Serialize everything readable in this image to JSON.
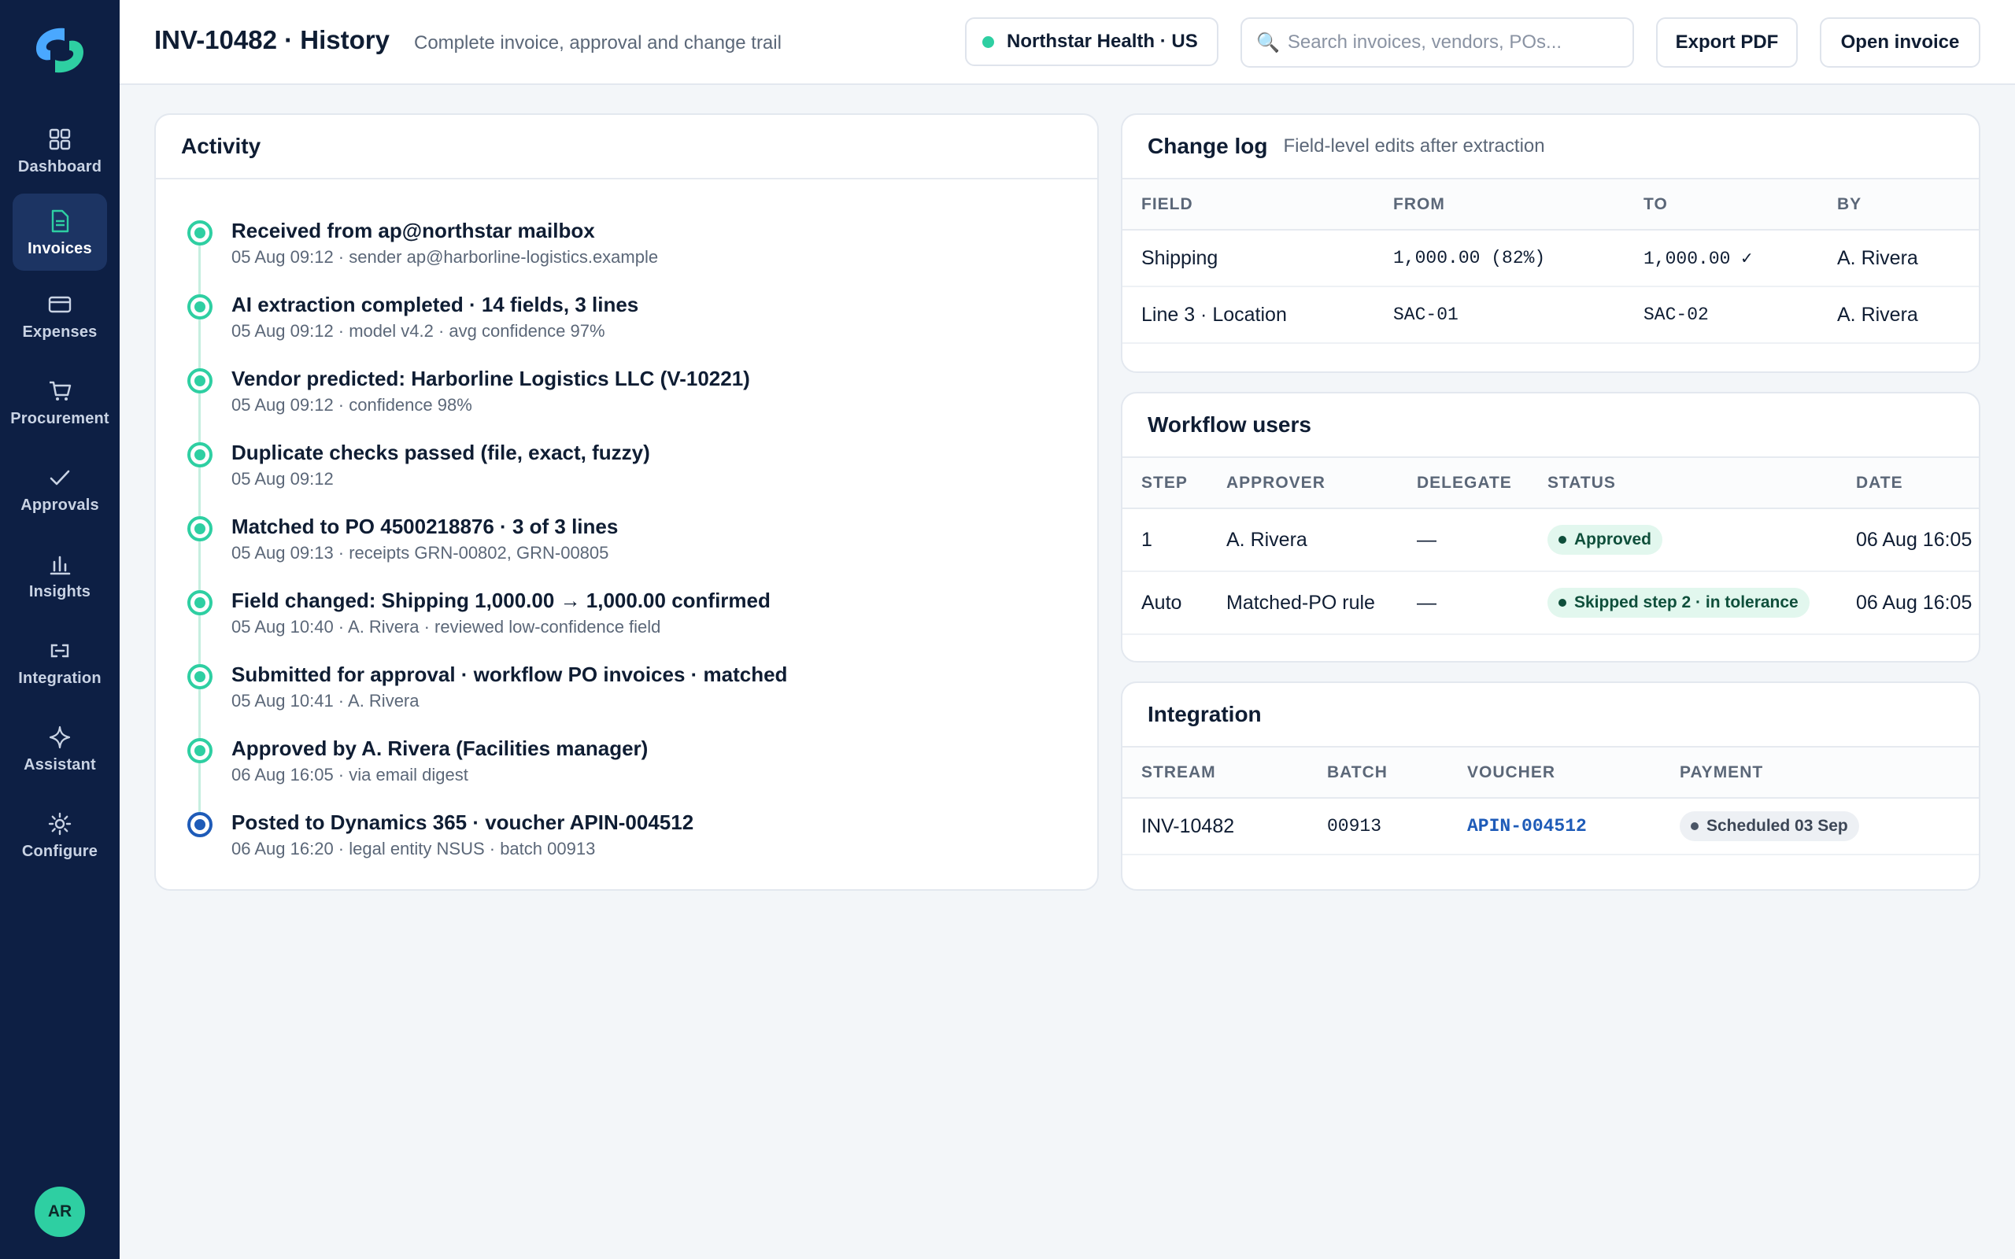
{
  "nav": {
    "items": [
      {
        "label": "Dashboard",
        "icon": "dashboard-icon"
      },
      {
        "label": "Invoices",
        "icon": "document-icon",
        "active": true
      },
      {
        "label": "Expenses",
        "icon": "card-icon"
      },
      {
        "label": "Procurement",
        "icon": "cart-icon"
      },
      {
        "label": "Approvals",
        "icon": "check-icon"
      },
      {
        "label": "Insights",
        "icon": "bar-chart-icon"
      },
      {
        "label": "Integration",
        "icon": "link-icon"
      },
      {
        "label": "Assistant",
        "icon": "sparkle-icon"
      },
      {
        "label": "Configure",
        "icon": "gear-icon"
      }
    ],
    "avatar": "AR"
  },
  "header": {
    "title": "INV-10482 · History",
    "subtitle": "Complete invoice, approval and change trail",
    "entity": "Northstar Health · US",
    "search_placeholder": "Search invoices, vendors, POs...",
    "export_label": "Export PDF",
    "open_label": "Open invoice"
  },
  "activity": {
    "title": "Activity",
    "items": [
      {
        "title": "Received from ap@northstar mailbox",
        "meta": "05 Aug 09:12 · sender ap@harborline-logistics.example"
      },
      {
        "title": "AI extraction completed · 14 fields, 3 lines",
        "meta": "05 Aug 09:12 · model v4.2 · avg confidence 97%"
      },
      {
        "title": "Vendor predicted: Harborline Logistics LLC (V-10221)",
        "meta": "05 Aug 09:12 · confidence 98%"
      },
      {
        "title": "Duplicate checks passed (file, exact, fuzzy)",
        "meta": "05 Aug 09:12"
      },
      {
        "title": "Matched to PO 4500218876 · 3 of 3 lines",
        "meta": "05 Aug 09:13 · receipts GRN-00802, GRN-00805"
      },
      {
        "title": "Field changed: Shipping 1,000.00 → 1,000.00 confirmed",
        "meta": "05 Aug 10:40 · A. Rivera · reviewed low-confidence field"
      },
      {
        "title": "Submitted for approval · workflow PO invoices · matched",
        "meta": "05 Aug 10:41 · A. Rivera"
      },
      {
        "title": "Approved by A. Rivera (Facilities manager)",
        "meta": "06 Aug 16:05 · via email digest"
      },
      {
        "title": "Posted to Dynamics 365 · voucher APIN-004512",
        "meta": "06 Aug 16:20 · legal entity NSUS · batch 00913"
      }
    ]
  },
  "changelog": {
    "title": "Change log",
    "subtitle": "Field-level edits after extraction",
    "columns": [
      "FIELD",
      "FROM",
      "TO",
      "BY"
    ],
    "rows": [
      [
        "Shipping",
        "1,000.00 (82%)",
        "1,000.00 ✓",
        "A. Rivera"
      ],
      [
        "Line 3 · Location",
        "SAC-01",
        "SAC-02",
        "A. Rivera"
      ]
    ]
  },
  "workflow": {
    "title": "Workflow users",
    "columns": [
      "STEP",
      "APPROVER",
      "DELEGATE",
      "STATUS",
      "DATE"
    ],
    "rows": [
      [
        "1",
        "A. Rivera",
        "—",
        "Approved",
        "06 Aug 16:05"
      ],
      [
        "Auto",
        "Matched-PO rule",
        "—",
        "Skipped step 2 · in tolerance",
        "06 Aug 16:05"
      ]
    ]
  },
  "integration": {
    "title": "Integration",
    "columns": [
      "STREAM",
      "BATCH",
      "VOUCHER",
      "PAYMENT"
    ],
    "rows": [
      [
        "INV-10482",
        "00913",
        "APIN-004512",
        "Scheduled 03 Sep"
      ]
    ]
  },
  "colors": {
    "accent": "#2ecfa2",
    "sidebar": "#0d1f44",
    "link": "#1e5bb8"
  }
}
